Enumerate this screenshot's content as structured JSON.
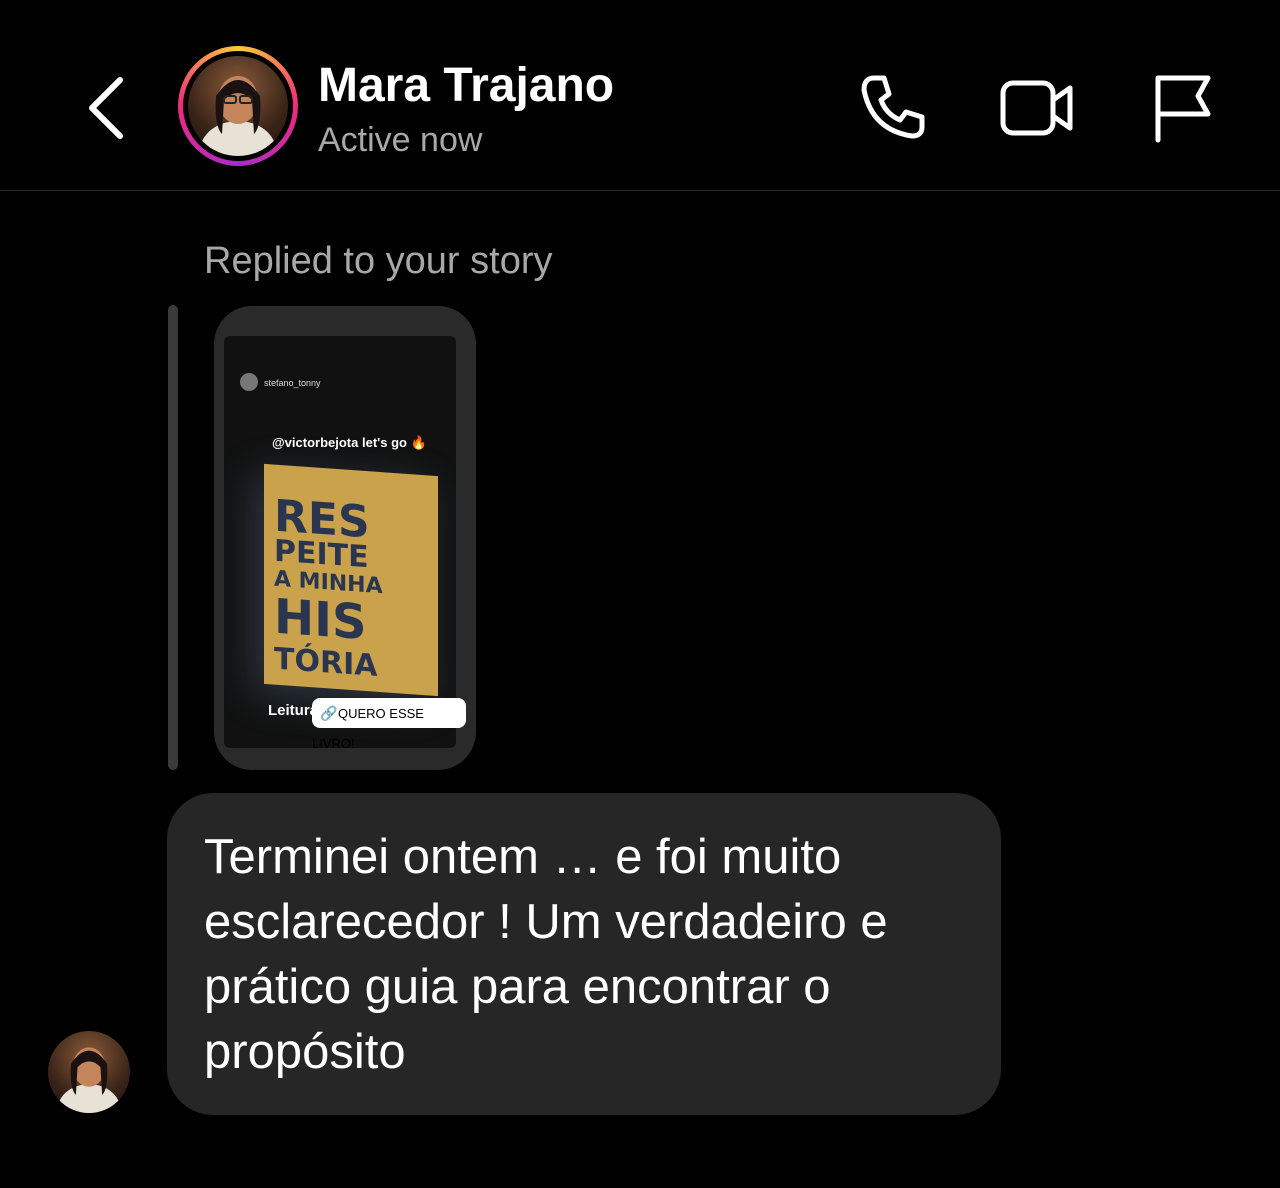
{
  "header": {
    "name": "Mara Trajano",
    "status": "Active now"
  },
  "thread": {
    "replied_label": "Replied to your story",
    "story": {
      "username": "stefano_tonny",
      "mention": "@victorbejota let's go 🔥",
      "book_title_lines": [
        "RES",
        "PEITE",
        "A MINHA",
        "HIS",
        "TÓRIA"
      ],
      "caption": "Leitura da semana",
      "link_label": "QUERO ESSE LIVRO!"
    },
    "message": "Terminei ontem … e foi muito esclarecedor ! Um verdadeiro e prático guia para encontrar o propósito"
  },
  "icons": {
    "back": "chevron-left-icon",
    "call": "phone-icon",
    "video": "video-camera-icon",
    "report": "flag-icon",
    "link": "link-icon"
  },
  "colors": {
    "background": "#000000",
    "bubble": "#262626",
    "secondary_text": "#a8a8a8",
    "story_ring": [
      "#f9ce34",
      "#ee2a7b",
      "#a42ec8"
    ]
  }
}
